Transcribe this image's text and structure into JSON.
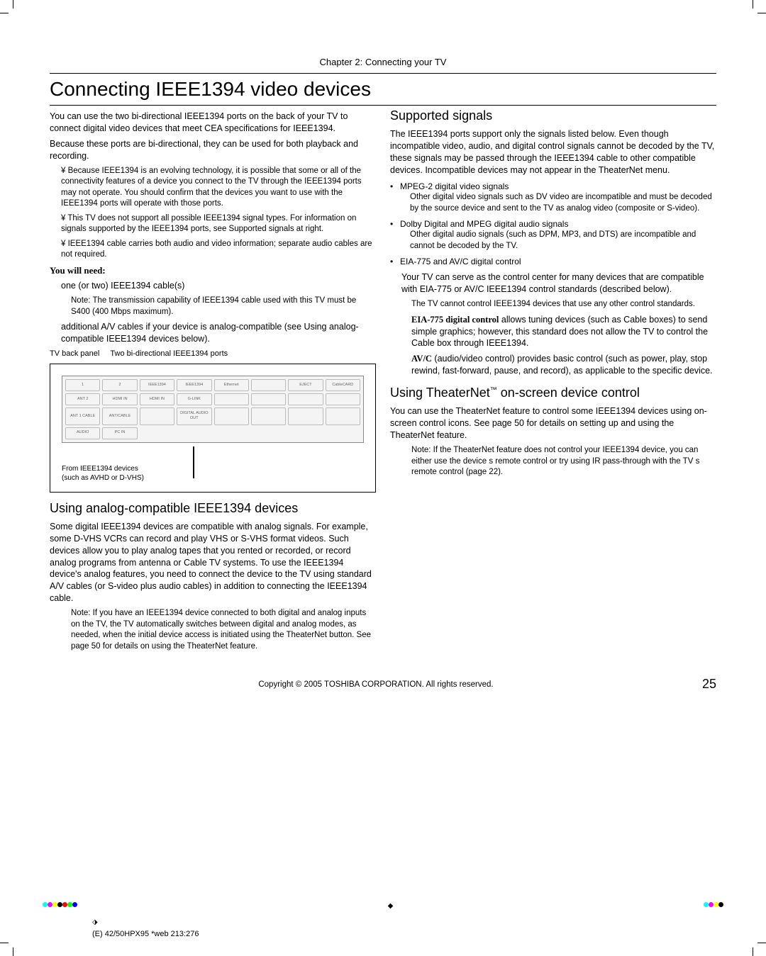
{
  "chapter": "Chapter 2: Connecting your TV",
  "title": "Connecting IEEE1394 video devices",
  "left": {
    "p1": "You can use the two bi-directional IEEE1394 ports on the back of your TV to connect digital video devices that meet CEA specifications for IEEE1394.",
    "p2": "Because these ports are bi-directional, they can be used for both playback and recording.",
    "bullet1": "Because IEEE1394 is an evolving technology, it is possible that some or all of the connectivity features of a device you connect to the TV through the IEEE1394 ports may not operate. You should confirm that the devices you want to use with the IEEE1394 ports will operate with those ports.",
    "bullet2": "This TV does not support all possible IEEE1394 signal types. For information on signals supported by the IEEE1394 ports, see Supported signals  at right.",
    "bullet3": "IEEE1394 cable carries both audio and video information; separate audio cables are not required.",
    "need_heading": "You will need:",
    "need_item": "one (or two) IEEE1394 cable(s)",
    "need_note": "Note: The transmission capability of IEEE1394 cable used with this TV must be S400 (400 Mbps maximum).",
    "need_p2": "additional A/V cables if your device is analog-compatible (see Using analog-compatible IEEE1394 devices below).",
    "panel_label_left": "TV back panel",
    "panel_label_right": "Two bi-directional IEEE1394 ports",
    "panel_ports": {
      "a": "1",
      "b": "2",
      "c": "ANT 2",
      "d": "ANT/CABLE",
      "e": "HDMI IN",
      "f": "G-LINK",
      "g": "IEEE1394",
      "h": "Ethernet",
      "i": "ANT 1 CABLE",
      "j": "AUDIO",
      "k": "PC IN",
      "l": "DIGITAL AUDIO OUT",
      "m": "EJECT",
      "n": "CableCARD"
    },
    "from_label": "From IEEE1394 devices\n(such as AVHD or D-VHS)",
    "h2_analog": "Using analog-compatible IEEE1394 devices",
    "analog_p": "Some digital IEEE1394 devices are compatible with analog signals. For example, some D-VHS VCRs can record and play VHS or S-VHS format videos. Such devices allow you to play analog tapes that you rented or recorded, or record analog programs from antenna or Cable TV systems. To use the IEEE1394 device's analog features, you need to connect the device to the TV using standard A/V cables (or S-video plus audio cables) in addition to connecting the IEEE1394 cable.",
    "analog_note": "Note: If you have an IEEE1394 device connected to both digital and analog inputs on the TV, the TV automatically switches between digital and analog modes, as needed, when the initial device access is initiated using the TheaterNet button. See page 50 for details on using the TheaterNet feature."
  },
  "right": {
    "h2_supported": "Supported signals",
    "sup_p1": "The IEEE1394 ports support only the signals listed below. Even though incompatible video, audio, and digital control signals cannot be decoded by the TV, these signals may be passed through the IEEE1394 cable to other compatible devices. Incompatible devices may not appear in the TheaterNet menu.",
    "b1": "MPEG-2 digital video signals",
    "b1d": "Other digital video signals such as DV video are incompatible and must be decoded by the source device and sent to the TV as analog video (composite or S-video).",
    "b2": "Dolby Digital and MPEG digital audio signals",
    "b2d": "Other digital audio signals (such as DPM, MP3, and DTS) are incompatible and cannot be decoded by the TV.",
    "b3": "EIA-775 and AV/C digital control",
    "ctrl_p1": "Your TV can serve as the control center for many devices that are compatible with EIA-775 or AV/C IEEE1394 control standards (described below).",
    "ctrl_note": "The TV cannot control IEEE1394 devices that use any other control standards.",
    "eia_label": "EIA-775 digital control",
    "eia_text": " allows tuning devices (such as Cable boxes) to send simple graphics; however, this standard does not allow the TV to control the Cable box through IEEE1394.",
    "avc_label": "AV/C",
    "avc_text": " (audio/video control) provides basic control (such as power, play, stop rewind, fast-forward, pause, and record), as applicable to the specific device.",
    "h2_theater_a": "Using TheaterNet",
    "h2_theater_b": " on-screen device control",
    "tm": "™",
    "theater_p": "You can use the TheaterNet feature to control some IEEE1394 devices using on-screen control icons. See page 50 for details on setting up and using the TheaterNet feature.",
    "theater_note": "Note: If the TheaterNet feature does not control your IEEE1394 device, you can either use the device s remote control or try using IR pass-through with the TV s remote control (page 22)."
  },
  "footer": {
    "copyright": "Copyright © 2005 TOSHIBA CORPORATION. All rights reserved.",
    "page": "25"
  },
  "slug": "(E) 42/50HPX95 *web 213:276"
}
